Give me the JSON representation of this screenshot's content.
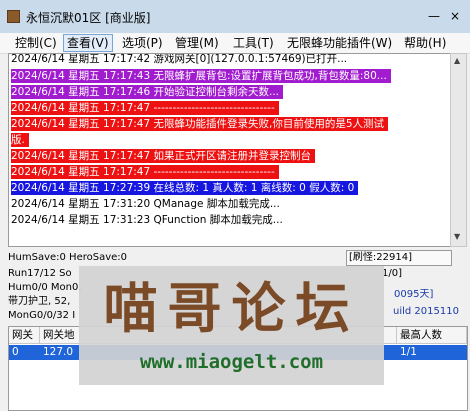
{
  "window": {
    "title": "永恒沉默01区 [商业版]",
    "minimize": "—",
    "close": "×"
  },
  "menu": [
    "控制(C)",
    "查看(V)",
    "选项(P)",
    "管理(M)",
    "工具(T)",
    "无限蜂功能插件(W)",
    "帮助(H)"
  ],
  "log": [
    {
      "text": "2024/6/14 星期五 17:17:42 游戏网关[0](127.0.0.1:57469)已打开...",
      "style": "plain"
    },
    {
      "text": "2024/6/14 星期五 17:17:43 无限蜂扩展背包:设置扩展背包成功,背包数量:80...",
      "style": "purple"
    },
    {
      "text": "2024/6/14 星期五 17:17:46 开始验证控制台剩余天数...",
      "style": "purple"
    },
    {
      "text": "2024/6/14 星期五 17:17:47 --------------------------------",
      "style": "red"
    },
    {
      "text": "2024/6/14 星期五 17:17:47 无限蜂功能插件登录失败,你目前使用的是5人测试",
      "style": "red"
    },
    {
      "text": "版.",
      "style": "red"
    },
    {
      "text": "2024/6/14 星期五 17:17:47 如果正式开区请注册并登录控制台",
      "style": "red"
    },
    {
      "text": "2024/6/14 星期五 17:17:47 --------------------------------",
      "style": "red"
    },
    {
      "text": "2024/6/14 星期五 17:27:39 在线总数: 1 真人数: 1 离线数: 0 假人数: 0",
      "style": "blue"
    },
    {
      "text": "2024/6/14 星期五 17:31:20 QManage 脚本加载完成...",
      "style": "plain"
    },
    {
      "text": "2024/6/14 星期五 17:31:23 QFunction 脚本加载完成...",
      "style": "plain"
    }
  ],
  "status": {
    "line1": "HumSave:0 HeroSave:0",
    "refresh": "[刷怪:22914]",
    "line2": "Run17/12 So",
    "count": "1/0]",
    "line3": "Hum0/0 Mon0,",
    "line4": "带刀护卫, 52,",
    "day": "0095天]",
    "line5": "MonG0/0/32 I",
    "build": "uild 2015110"
  },
  "table": {
    "headers": [
      "网关",
      "网关地",
      "最高人数"
    ],
    "row": [
      "0",
      "127.0",
      "1/1"
    ]
  },
  "watermark": {
    "title": "喵哥论坛",
    "url": "www.miaogelt.com"
  }
}
